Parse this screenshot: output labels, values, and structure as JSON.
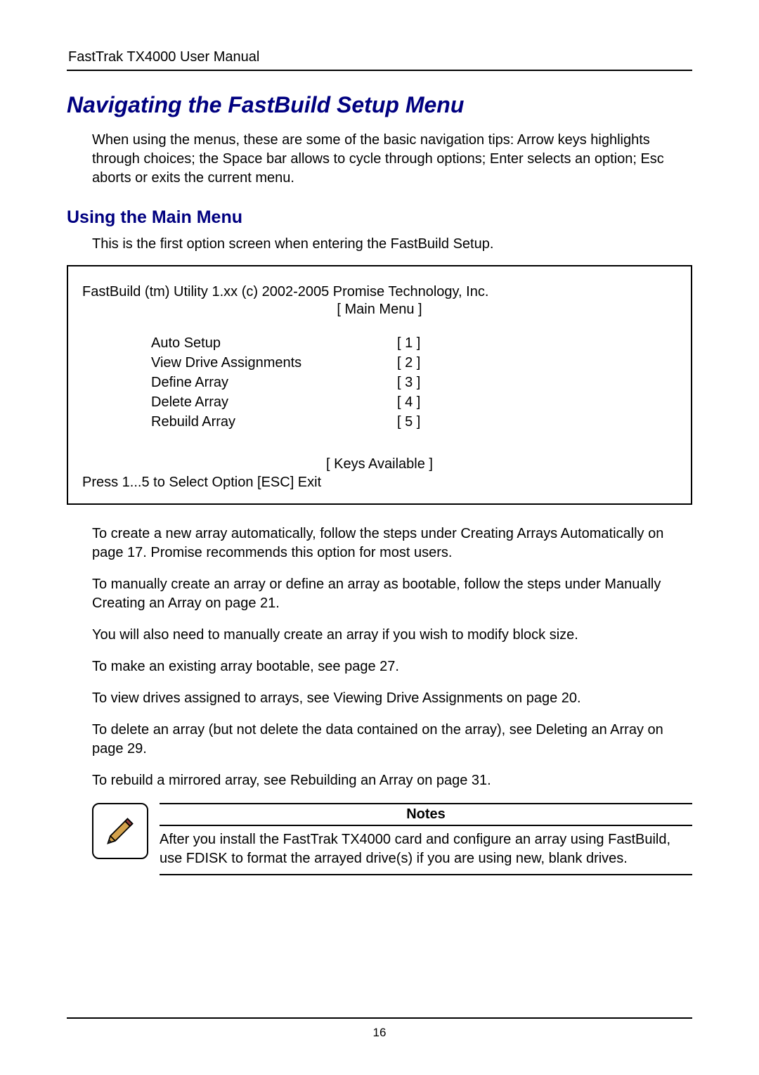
{
  "header": "FastTrak TX4000 User Manual",
  "title": "Navigating the FastBuild Setup Menu",
  "intro": "When using the menus, these are some of the basic navigation tips: Arrow keys highlights through choices; the Space bar allows to cycle through options; Enter selects an option; Esc aborts or exits the current menu.",
  "subtitle": "Using the Main Menu",
  "subtext": "This is the first option screen when entering the FastBuild Setup.",
  "menu": {
    "title_line": "FastBuild (tm) Utility 1.xx (c) 2002-2005 Promise Technology, Inc.",
    "subtitle": "[ Main Menu ]",
    "items": [
      {
        "label": "Auto Setup",
        "key": "[ 1 ]"
      },
      {
        "label": "View Drive Assignments",
        "key": "[ 2 ]"
      },
      {
        "label": "Define Array",
        "key": "[ 3 ]"
      },
      {
        "label": "Delete Array",
        "key": "[ 4 ]"
      },
      {
        "label": "Rebuild Array",
        "key": "[ 5 ]"
      }
    ],
    "keys_header": "[ Keys Available ]",
    "keys_instruction": "Press 1...5 to Select Option   [ESC] Exit"
  },
  "paragraphs": [
    "To create a new array automatically, follow the steps under Creating Arrays Automatically on page 17. Promise recommends this option for most users.",
    "To manually create an array or define an array as bootable, follow the steps under Manually Creating an Array on page 21.",
    "You will also need to manually create an array if you wish to modify block size.",
    "To make an existing array bootable, see page 27.",
    "To view drives assigned to arrays, see Viewing Drive Assignments on page 20.",
    "To delete an array (but not delete the data contained on the array), see Deleting an Array on page 29.",
    "To rebuild a mirrored array, see Rebuilding an Array on page 31."
  ],
  "notes": {
    "header": "Notes",
    "text": "After you install the FastTrak TX4000 card and configure an array using FastBuild, use FDISK to format the arrayed drive(s) if you are using new, blank drives."
  },
  "page_number": "16"
}
